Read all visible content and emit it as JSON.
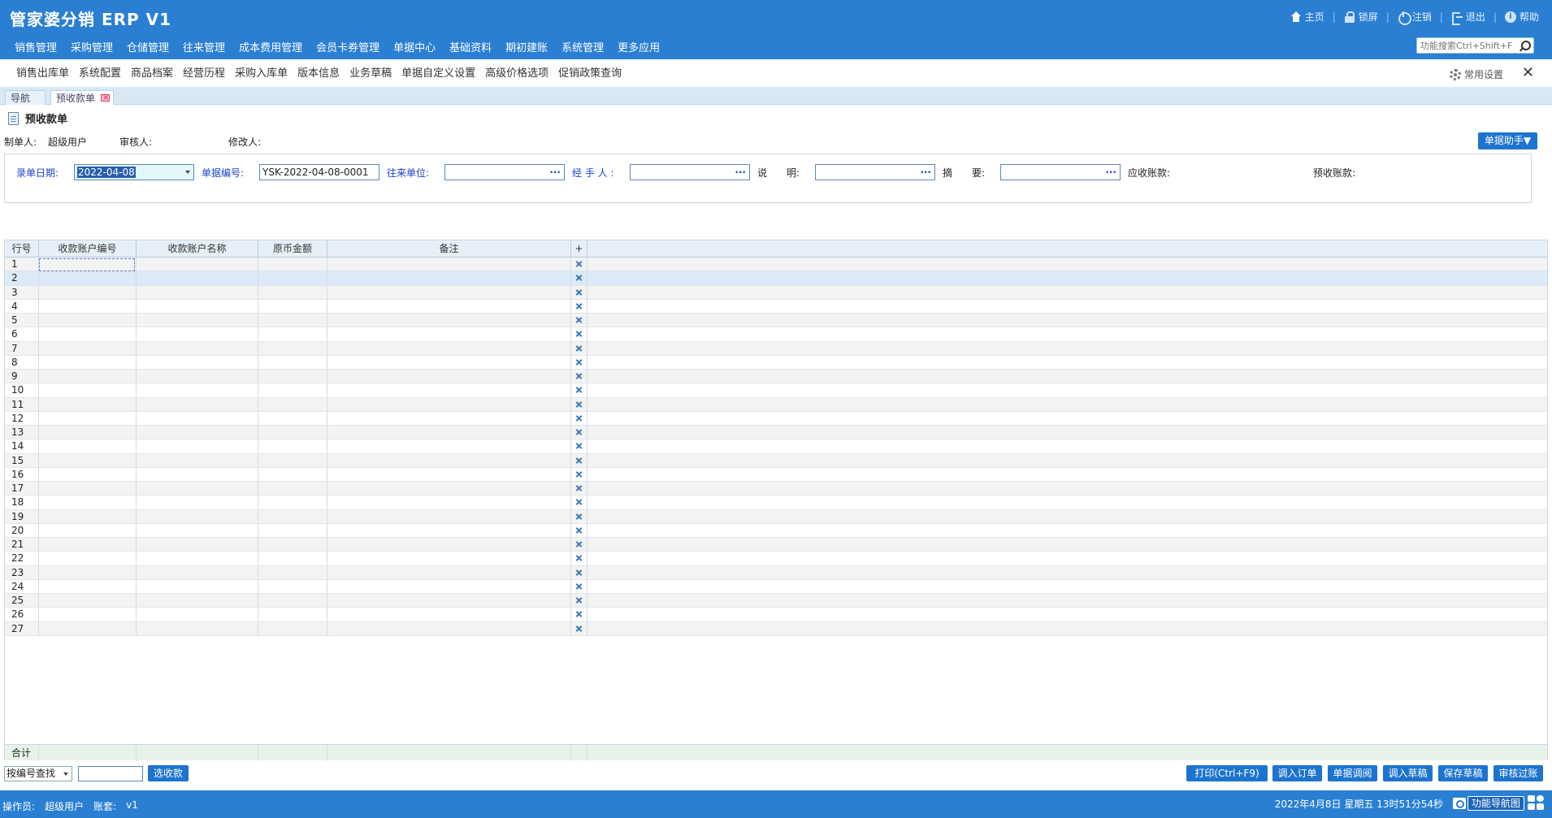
{
  "header": {
    "title": "管家婆分销 ERP V1",
    "top_links": [
      {
        "label": "主页",
        "icon": "home-icon"
      },
      {
        "label": "锁屏",
        "icon": "lock-icon"
      },
      {
        "label": "注销",
        "icon": "logout-icon"
      },
      {
        "label": "退出",
        "icon": "exit-icon"
      },
      {
        "label": "帮助",
        "icon": "help-icon"
      }
    ],
    "menu": [
      "销售管理",
      "采购管理",
      "仓储管理",
      "往来管理",
      "成本费用管理",
      "会员卡券管理",
      "单据中心",
      "基础资料",
      "期初建账",
      "系统管理",
      "更多应用"
    ],
    "search_placeholder": "功能搜索Ctrl+Shift+F"
  },
  "quick_links": [
    "销售出库单",
    "系统配置",
    "商品档案",
    "经营历程",
    "采购入库单",
    "版本信息",
    "业务草稿",
    "单据自定义设置",
    "高级价格选项",
    "促销政策查询"
  ],
  "common_settings": "常用设置",
  "close_symbol": "✕",
  "tabs": [
    {
      "label": "导航"
    },
    {
      "label": "预收款单"
    }
  ],
  "document": {
    "title": "预收款单",
    "creator_label": "制单人:",
    "creator_value": "超级用户",
    "reviewer_label": "审核人:",
    "modifier_label": "修改人:",
    "assistant_button": "单据助手▼"
  },
  "form": {
    "date_label": "录单日期:",
    "date_value": "2022-04-08",
    "doc_no_label": "单据编号:",
    "doc_no_value": "YSK-2022-04-08-0001",
    "partner_label": "往来单位:",
    "handler_label": "经 手 人 :",
    "desc_label": "说　　明:",
    "summary_label": "摘　　要:",
    "receivable_label": "应收账款:",
    "prepaid_label": "预收账款:",
    "ellipsis": "···"
  },
  "grid": {
    "columns": [
      "行号",
      "收款账户编号",
      "收款账户名称",
      "原币金额",
      "备注",
      "+"
    ],
    "rows": [
      "1",
      "2",
      "3",
      "4",
      "5",
      "6",
      "7",
      "8",
      "9",
      "10",
      "11",
      "12",
      "13",
      "14",
      "15",
      "16",
      "17",
      "18",
      "19",
      "20",
      "21",
      "22",
      "23",
      "24",
      "25",
      "26",
      "27"
    ],
    "total_label": "合计"
  },
  "bottom": {
    "search_type": "按编号查找",
    "select_button": "选收款",
    "buttons": [
      "打印(Ctrl+F9)",
      "调入订单",
      "单据调阅",
      "调入草稿",
      "保存草稿",
      "审核过账"
    ]
  },
  "status": {
    "operator_label": "操作员:",
    "operator_value": "超级用户",
    "account_label": "账套:",
    "account_value": "v1",
    "datetime": "2022年4月8日  星期五  13时51分54秒",
    "nav_map_button": "功能导航图"
  },
  "colors": {
    "header_blue": "#2a7fd3",
    "button_blue": "#1d74cf",
    "label_blue": "#1a43c8"
  }
}
